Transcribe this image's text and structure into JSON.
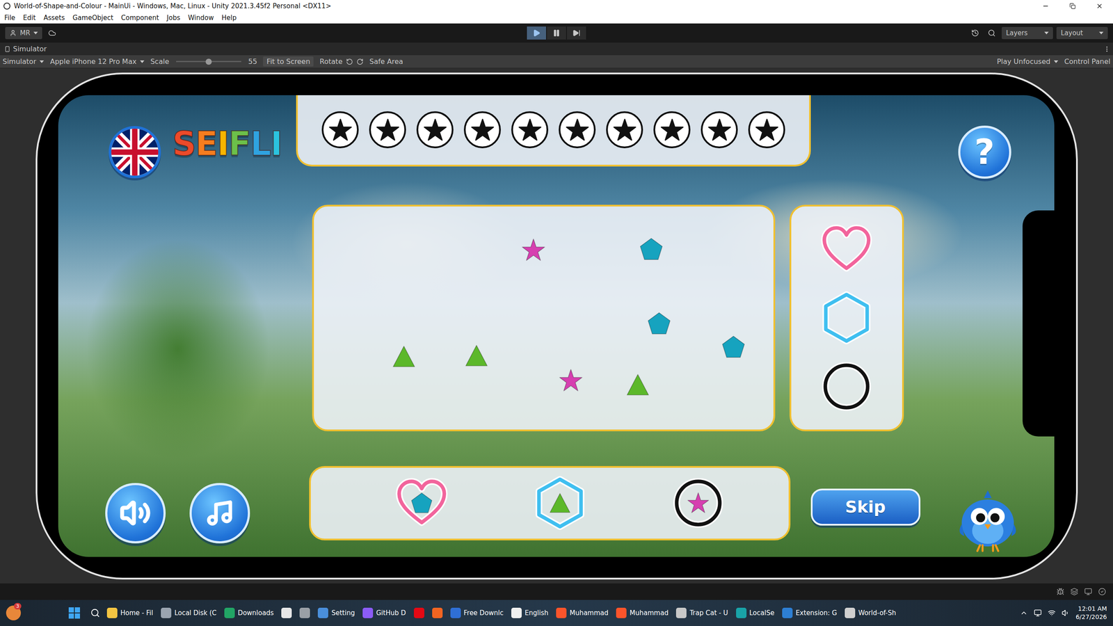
{
  "window": {
    "title": "World-of-Shape-and-Colour - MainUi - Windows, Mac, Linux - Unity 2021.3.45f2 Personal <DX11>"
  },
  "menu": [
    "File",
    "Edit",
    "Assets",
    "GameObject",
    "Component",
    "Jobs",
    "Window",
    "Help"
  ],
  "toolbar": {
    "account": "MR",
    "play_controls": [
      {
        "name": "play",
        "selected": true
      },
      {
        "name": "pause",
        "selected": false
      },
      {
        "name": "step",
        "selected": false
      }
    ],
    "layers": "Layers",
    "layout": "Layout"
  },
  "panel_tab": "Simulator",
  "simulator_bar": {
    "mode": "Simulator",
    "device": "Apple iPhone 12 Pro Max",
    "scale_label": "Scale",
    "scale": {
      "level": 0.5,
      "reading": "55"
    },
    "fit": "Fit to Screen",
    "rotate": "Rotate",
    "safe_area": "Safe Area",
    "play_mode": "Play Unfocused",
    "control_panel": "Control Panel"
  },
  "game": {
    "logo": "SEIFLI",
    "help": "?",
    "star_row": {
      "stars": 10,
      "slots": 10
    },
    "canvas_shapes": [
      {
        "kind": "star",
        "color": "#d63fb0"
      },
      {
        "kind": "pentagon",
        "color": "#16a3bf"
      },
      {
        "kind": "pentagon",
        "color": "#16a3bf"
      },
      {
        "kind": "pentagon",
        "color": "#16a3bf"
      },
      {
        "kind": "triangle",
        "color": "#5cb82a"
      },
      {
        "kind": "triangle",
        "color": "#5cb82a"
      },
      {
        "kind": "star",
        "color": "#d63fb0"
      },
      {
        "kind": "triangle",
        "color": "#5cb82a"
      }
    ],
    "targets": [
      {
        "kind": "heart",
        "color": "#f2649c"
      },
      {
        "kind": "hexagon",
        "color": "#3fbff0"
      },
      {
        "kind": "circle",
        "color": "#111111"
      }
    ],
    "matches": [
      {
        "kind": "heart",
        "color": "#f2649c",
        "inner": "pentagon",
        "inner_color": "#16a3bf"
      },
      {
        "kind": "hexagon",
        "color": "#3fbff0",
        "inner": "triangle",
        "inner_color": "#5cb82a"
      },
      {
        "kind": "circle",
        "color": "#111111",
        "inner": "star",
        "inner_color": "#d63fb0"
      }
    ],
    "skip": "Skip"
  },
  "taskbar": {
    "notification_count": "3",
    "apps": [
      {
        "label": "Home - Fil",
        "color": "#f4c542"
      },
      {
        "label": "Local Disk (C",
        "color": "#9aa4b0"
      },
      {
        "label": "Downloads",
        "color": "#22a565"
      },
      {
        "label": "",
        "color": "#e7e7e7"
      },
      {
        "label": "",
        "color": "#9aa0a6"
      },
      {
        "label": "Setting",
        "color": "#4a8fdb"
      },
      {
        "label": "GitHub D",
        "color": "#8b5cf6"
      },
      {
        "label": "",
        "color": "#e50914"
      },
      {
        "label": "",
        "color": "#f26522"
      },
      {
        "label": "Free Downlc",
        "color": "#2f6fd6"
      },
      {
        "label": "English",
        "color": "#f0f0f0"
      },
      {
        "label": "Muhammad",
        "color": "#fb542b"
      },
      {
        "label": "Muhammad",
        "color": "#fb542b"
      },
      {
        "label": "Trap Cat - U",
        "color": "#c8c8c8"
      },
      {
        "label": "LocalSe",
        "color": "#19a3a8"
      },
      {
        "label": "Extension: G",
        "color": "#2d7fd3"
      },
      {
        "label": "World-of-Sh",
        "color": "#d0d0d0"
      }
    ],
    "time": "12:01 AM",
    "date": "6/27/2026"
  }
}
